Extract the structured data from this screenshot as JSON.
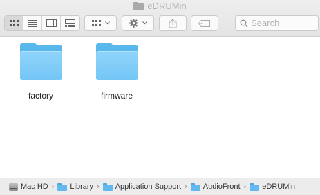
{
  "window": {
    "title": "eDRUMin"
  },
  "toolbar": {
    "view_buttons": [
      {
        "name": "icon-view",
        "icon": "grid-icon",
        "active": true
      },
      {
        "name": "list-view",
        "icon": "list-icon",
        "active": false
      },
      {
        "name": "column-view",
        "icon": "columns-icon",
        "active": false
      },
      {
        "name": "gallery-view",
        "icon": "gallery-icon",
        "active": false
      }
    ],
    "group_button_icon": "grid-dropdown-icon",
    "action_button_icon": "gear-icon",
    "share_button_icon": "share-icon",
    "tag_button_icon": "tag-icon",
    "search": {
      "placeholder": "Search",
      "value": ""
    }
  },
  "content": {
    "items": [
      {
        "label": "factory",
        "icon": "folder-icon"
      },
      {
        "label": "firmware",
        "icon": "folder-icon"
      }
    ]
  },
  "pathbar": {
    "crumbs": [
      "Mac HD",
      "Library",
      "Application Support",
      "AudioFront",
      "eDRUMin"
    ],
    "separator": "›"
  },
  "colors": {
    "folder_front": "#74c6f6",
    "folder_back": "#58b8ec",
    "toolbar_bg": "#e8e8e8",
    "pathbar_bg": "#ececec"
  }
}
